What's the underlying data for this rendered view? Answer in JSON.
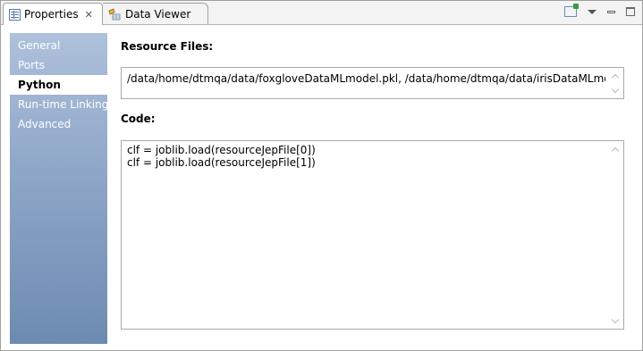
{
  "tabs": {
    "properties": {
      "label": "Properties",
      "close": "✕"
    },
    "data_viewer": {
      "label": "Data Viewer"
    }
  },
  "toolbar": {
    "icons": [
      "pin-view-icon",
      "view-menu-icon",
      "minimize-icon",
      "maximize-icon"
    ]
  },
  "sidebar": {
    "items": [
      {
        "label": "General"
      },
      {
        "label": "Ports"
      },
      {
        "label": "Python",
        "selected": true
      },
      {
        "label": "Run-time Linking"
      },
      {
        "label": "Advanced"
      }
    ]
  },
  "main": {
    "resource_files_label": "Resource Files:",
    "resource_files_value": "/data/home/dtmqa/data/foxgloveDataMLmodel.pkl, /data/home/dtmqa/data/irisDataMLmodel.pkl",
    "code_label": "Code:",
    "code_lines": [
      "clf = joblib.load(resourceJepFile[0])",
      "clf = joblib.load(resourceJepFile[1])"
    ]
  },
  "colors": {
    "sidebar_top": "#aec1dc",
    "sidebar_bottom": "#6d8bb2",
    "selected_item_bg": "#ffffff"
  }
}
